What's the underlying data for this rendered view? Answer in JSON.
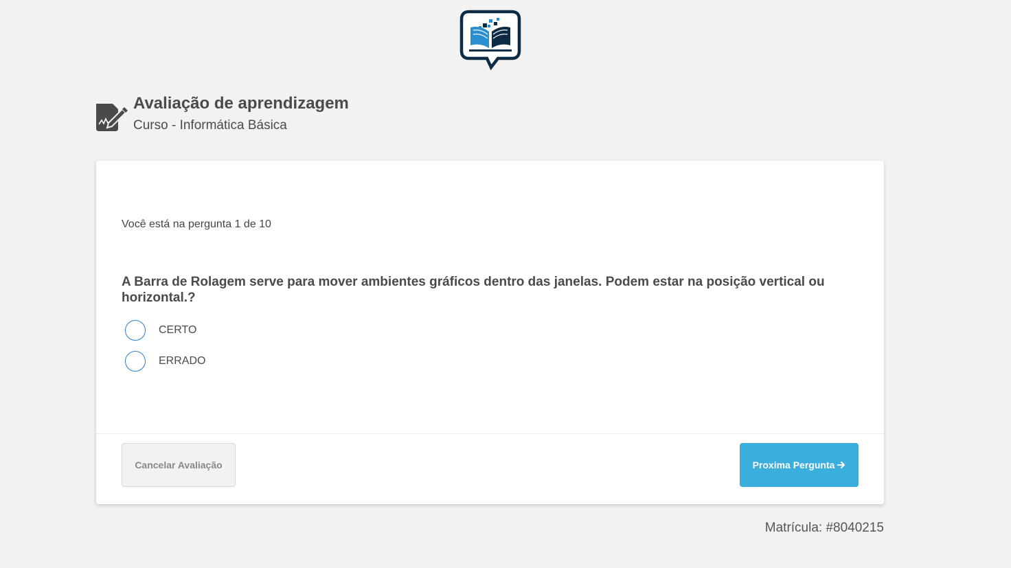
{
  "header": {
    "title": "Avaliação de aprendizagem",
    "subtitle": "Curso - Informática Básica"
  },
  "quiz": {
    "progress_text": "Você está na pergunta 1 de 10",
    "question": "A Barra de Rolagem serve para mover ambientes gráficos dentro das janelas. Podem estar na posição vertical ou horizontal.?",
    "options": [
      {
        "label": "CERTO",
        "selected": false
      },
      {
        "label": "ERRADO",
        "selected": false
      }
    ]
  },
  "footer": {
    "cancel_label": "Cancelar Avaliação",
    "next_label": "Proxima Pergunta"
  },
  "registration": "Matrícula: #8040215",
  "colors": {
    "accent": "#3aaedc",
    "radio_border": "#2a7fc9",
    "logo_dark": "#0d2b45",
    "logo_blue": "#2a8fd0",
    "background": "#f2f2f2"
  },
  "icons": {
    "logo": "book-chat-logo-icon",
    "header": "document-edit-icon",
    "next": "arrow-right-icon"
  }
}
